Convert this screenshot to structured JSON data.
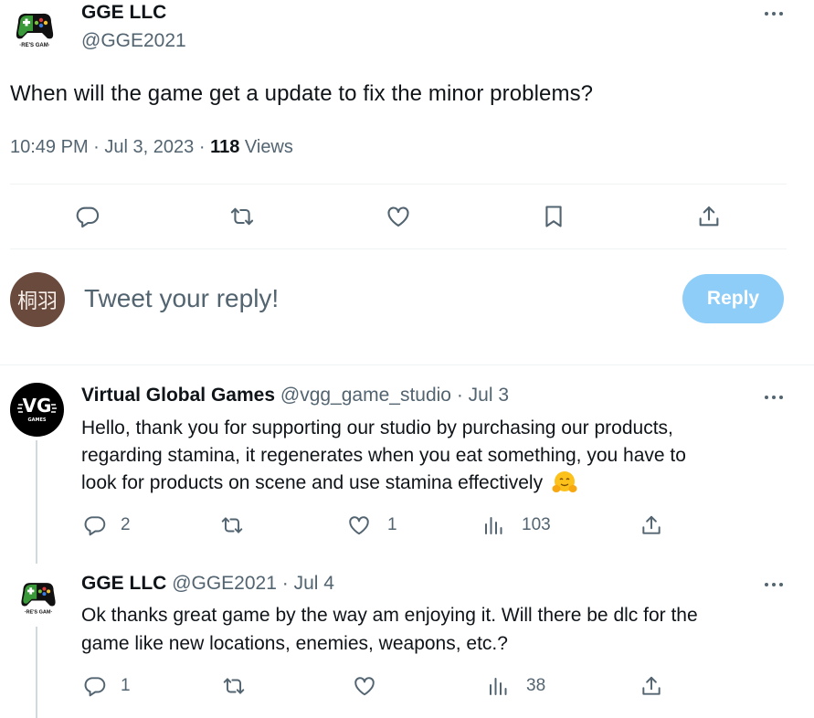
{
  "main_tweet": {
    "author_name": "GGE LLC",
    "author_handle": "@GGE2021",
    "text": "When will the game get a update to fix the minor problems?",
    "time": "10:49 PM",
    "dot": "·",
    "date": "Jul 3, 2023",
    "views_count": "118",
    "views_label": "Views"
  },
  "reply_box": {
    "avatar_text": "桐羽",
    "placeholder": "Tweet your reply!",
    "button_label": "Reply"
  },
  "replies": [
    {
      "author_name": "Virtual Global Games",
      "author_handle": "@vgg_game_studio",
      "date": "Jul 3",
      "avatar_text": "VG",
      "avatar_subtext": "GAMES",
      "lines": [
        "Hello, thank you for supporting our studio by purchasing our products,",
        "regarding stamina, it regenerates when you eat something, you have to",
        "look for products on scene and use stamina effectively"
      ],
      "emoji": "🤗",
      "replies_count": "2",
      "likes_count": "1",
      "views_count": "103"
    },
    {
      "author_name": "GGE LLC",
      "author_handle": "@GGE2021",
      "date": "Jul 4",
      "lines": [
        "Ok thanks great game by the way am enjoying it. Will there be dlc for the",
        "game like new locations, enemies, weapons, etc.?"
      ],
      "replies_count": "1",
      "likes_count": "",
      "views_count": "38"
    }
  ],
  "colors": {
    "text": "#0f1419",
    "muted": "#536471",
    "reply_button_disabled": "#8ecdf8",
    "divider": "#eff3f4"
  }
}
